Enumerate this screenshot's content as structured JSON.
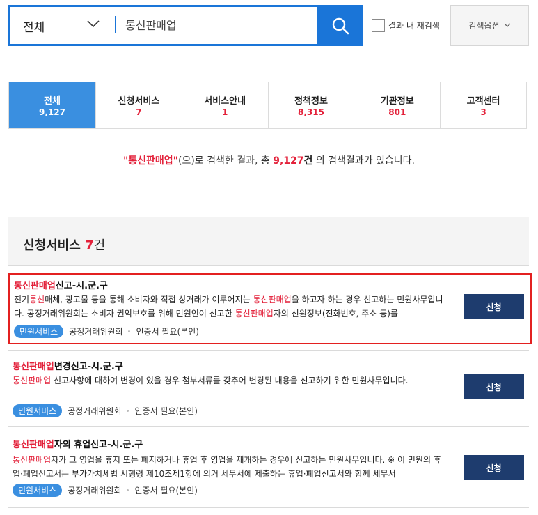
{
  "search": {
    "scope": "전체",
    "query": "통신판매업",
    "re_search_label": "결과 내 재검색",
    "options_label": "검색옵션"
  },
  "tabs": [
    {
      "label": "전체",
      "count": "9,127"
    },
    {
      "label": "신청서비스",
      "count": "7"
    },
    {
      "label": "서비스안내",
      "count": "1"
    },
    {
      "label": "정책정보",
      "count": "8,315"
    },
    {
      "label": "기관정보",
      "count": "801"
    },
    {
      "label": "고객센터",
      "count": "3"
    }
  ],
  "summary": {
    "keyword": "\"통신판매업\"",
    "text1": "(으)로 검색한 결과, 총 ",
    "total": "9,127",
    "unit": "건",
    "text2": " 의 검색결과가 있습니다."
  },
  "section": {
    "title": "신청서비스 ",
    "count": "7",
    "unit": "건"
  },
  "results": [
    {
      "title_hl": "통신판매업",
      "title_rest": "신고-시.군.구",
      "desc_parts": [
        {
          "t": "전기",
          "hl": false
        },
        {
          "t": "통신",
          "hl": true
        },
        {
          "t": "매체, 광고물 등을 통해 소비자와 직접 상거래가 이루어지는 ",
          "hl": false
        },
        {
          "t": "통신판매업",
          "hl": true
        },
        {
          "t": "을 하고자 하는 경우 신고하는 민원사무입니다. 공정거래위원회는 소비자 권익보호를 위해 민원인이 신고한 ",
          "hl": false
        },
        {
          "t": "통신판매업",
          "hl": true
        },
        {
          "t": "자의 신원정보(전화번호, 주소 등)를",
          "hl": false
        }
      ],
      "badge": "민원서비스",
      "agency": "공정거래위원회",
      "cert": "인증서 필요(본인)",
      "apply": "신청"
    },
    {
      "title_hl": "통신판매업",
      "title_rest": "변경신고-시.군.구",
      "desc_parts": [
        {
          "t": "통신판매업",
          "hl": true
        },
        {
          "t": " 신고사항에 대하여 변경이 있을 경우 첨부서류를 갖추어 변경된 내용을 신고하기 위한 민원사무입니다.",
          "hl": false
        }
      ],
      "badge": "민원서비스",
      "agency": "공정거래위원회",
      "cert": "인증서 필요(본인)",
      "apply": "신청"
    },
    {
      "title_hl": "통신판매업",
      "title_rest": "자의 휴업신고-시.군.구",
      "desc_parts": [
        {
          "t": "통신판매업",
          "hl": true
        },
        {
          "t": "자가 그 영업을 휴지 또는 폐지하거나 휴업 후 영업을 재개하는 경우에 신고하는 민원사무입니다. ※ 이 민원의 휴업·폐업신고서는 부가가치세법 시행령 제10조제1항에 의거 세무서에 제출하는 휴업·폐업신고서와 함께 세무서",
          "hl": false
        }
      ],
      "badge": "민원서비스",
      "agency": "공정거래위원회",
      "cert": "인증서 필요(본인)",
      "apply": "신청"
    }
  ]
}
